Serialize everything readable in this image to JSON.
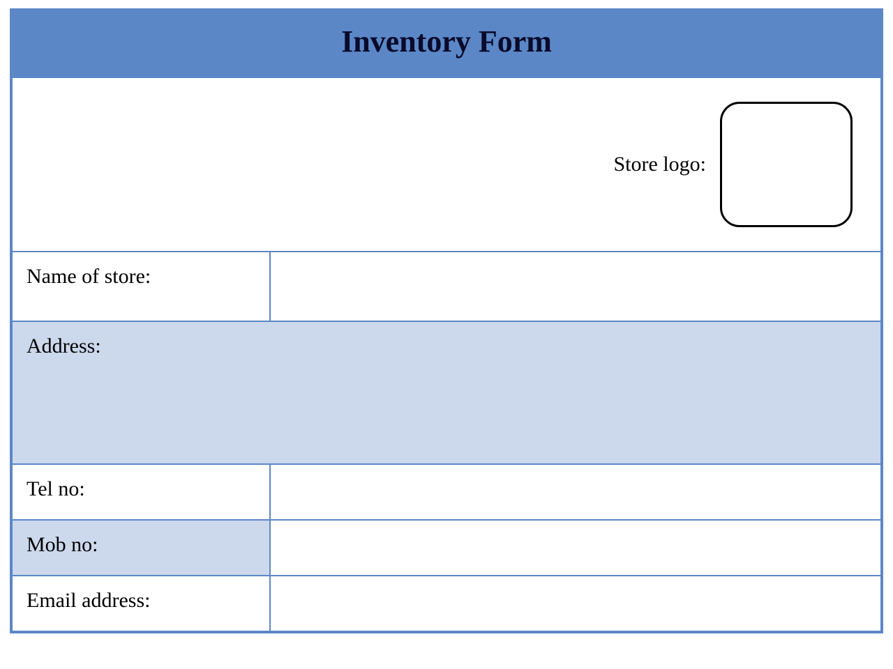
{
  "form": {
    "title": "Inventory Form",
    "logo_label": "Store logo:",
    "fields": {
      "name_label": "Name of store:",
      "name_value": "",
      "address_label": "Address:",
      "address_value": "",
      "tel_label": "Tel no:",
      "tel_value": "",
      "mob_label": "Mob no:",
      "mob_value": "",
      "email_label": "Email address:",
      "email_value": ""
    }
  }
}
